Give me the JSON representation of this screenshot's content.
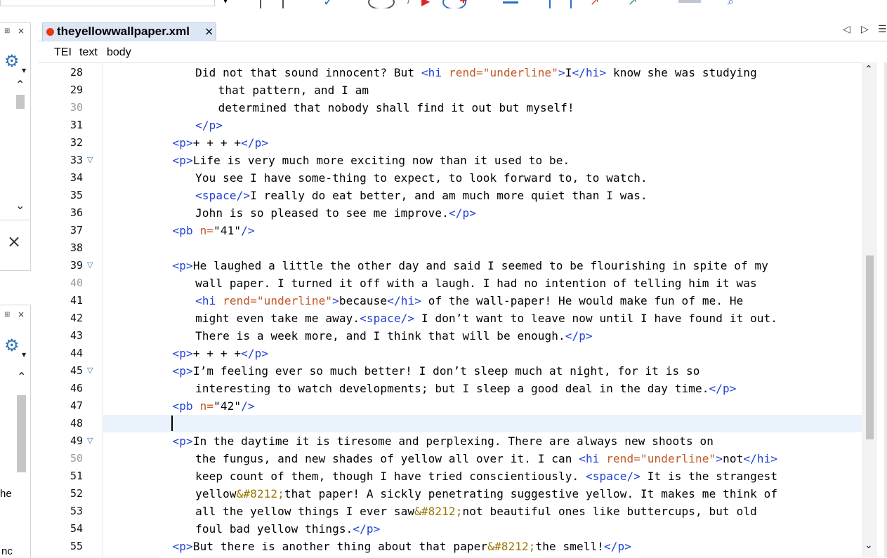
{
  "toolbar": {
    "icons": [
      "dropdown-icon",
      "validate-icon",
      "check-icon",
      "record-icon",
      "wand-icon",
      "run-icon",
      "debug-icon",
      "bug-icon",
      "bar-icon",
      "export-icon",
      "arrow-icon",
      "arrow2-icon",
      "book-icon",
      "search-icon"
    ]
  },
  "left_panels": {
    "upper": {
      "pin": "⊞",
      "close": "×",
      "closebig": "×"
    },
    "lower": {
      "pin": "⊞",
      "close": "×",
      "partial_text_1": "he",
      "partial_text_2": "nc"
    }
  },
  "tab": {
    "title": "theyellowwallpaper.xml",
    "close": "×",
    "modified_color": "#e8380d"
  },
  "breadcrumb": [
    "TEI",
    "text",
    "body"
  ],
  "editor": {
    "lines": [
      {
        "n": "28",
        "grey": false,
        "fold": false,
        "indent": 16,
        "parts": [
          [
            "t",
            "Did not that sound innocent? But "
          ],
          [
            "g",
            "<hi "
          ],
          [
            "a",
            "rend="
          ],
          [
            "a",
            "\"underline\""
          ],
          [
            "g",
            ">"
          ],
          [
            "t",
            "I"
          ],
          [
            "g",
            "</hi>"
          ],
          [
            "t",
            " know she was studying"
          ]
        ]
      },
      {
        "n": "29",
        "grey": false,
        "fold": false,
        "indent": 20,
        "parts": [
          [
            "t",
            "that pattern, and I am"
          ]
        ]
      },
      {
        "n": "30",
        "grey": true,
        "fold": false,
        "indent": 20,
        "parts": [
          [
            "t",
            "determined that nobody shall find it out but myself!"
          ]
        ]
      },
      {
        "n": "31",
        "grey": false,
        "fold": false,
        "indent": 16,
        "parts": [
          [
            "g",
            "</p>"
          ]
        ]
      },
      {
        "n": "32",
        "grey": false,
        "fold": false,
        "indent": 12,
        "parts": [
          [
            "g",
            "<p>"
          ],
          [
            "t",
            "+ + + +"
          ],
          [
            "g",
            "</p>"
          ]
        ]
      },
      {
        "n": "33",
        "grey": false,
        "fold": true,
        "indent": 12,
        "parts": [
          [
            "g",
            "<p>"
          ],
          [
            "t",
            "Life is very much more exciting now than it used to be."
          ]
        ]
      },
      {
        "n": "34",
        "grey": false,
        "fold": false,
        "indent": 16,
        "parts": [
          [
            "t",
            "You see I have some-thing to expect, to look forward to, to watch."
          ]
        ]
      },
      {
        "n": "35",
        "grey": false,
        "fold": false,
        "indent": 16,
        "parts": [
          [
            "g",
            "<space/>"
          ],
          [
            "t",
            "I really do eat better, and am much more quiet than I was."
          ]
        ]
      },
      {
        "n": "36",
        "grey": false,
        "fold": false,
        "indent": 16,
        "parts": [
          [
            "t",
            "John is so pleased to see me improve."
          ],
          [
            "g",
            "</p>"
          ]
        ]
      },
      {
        "n": "37",
        "grey": false,
        "fold": false,
        "indent": 12,
        "parts": [
          [
            "g",
            "<pb "
          ],
          [
            "a",
            "n="
          ],
          [
            "t",
            "\"41\""
          ],
          [
            "g",
            "/>"
          ]
        ]
      },
      {
        "n": "38",
        "grey": false,
        "fold": false,
        "indent": 0,
        "parts": []
      },
      {
        "n": "39",
        "grey": false,
        "fold": true,
        "indent": 12,
        "parts": [
          [
            "g",
            "<p>"
          ],
          [
            "t",
            "He laughed a little the other day and said I seemed to be flourishing in spite of my"
          ]
        ]
      },
      {
        "n": "40",
        "grey": true,
        "fold": false,
        "indent": 16,
        "parts": [
          [
            "t",
            "wall paper. I turned it off with a laugh. I had no intention of telling him it was"
          ]
        ]
      },
      {
        "n": "41",
        "grey": false,
        "fold": false,
        "indent": 16,
        "parts": [
          [
            "g",
            "<hi "
          ],
          [
            "a",
            "rend="
          ],
          [
            "a",
            "\"underline\""
          ],
          [
            "g",
            ">"
          ],
          [
            "t",
            "because"
          ],
          [
            "g",
            "</hi>"
          ],
          [
            "t",
            " of the wall-paper! He would make fun of me. He"
          ]
        ]
      },
      {
        "n": "42",
        "grey": false,
        "fold": false,
        "indent": 16,
        "parts": [
          [
            "t",
            "might even take me away."
          ],
          [
            "g",
            "<space/>"
          ],
          [
            "t",
            " I don’t want to leave now until I have found it out."
          ]
        ]
      },
      {
        "n": "43",
        "grey": false,
        "fold": false,
        "indent": 16,
        "parts": [
          [
            "t",
            "There is a week more, and I think that will be enough."
          ],
          [
            "g",
            "</p>"
          ]
        ]
      },
      {
        "n": "44",
        "grey": false,
        "fold": false,
        "indent": 12,
        "parts": [
          [
            "g",
            "<p>"
          ],
          [
            "t",
            "+ + + +"
          ],
          [
            "g",
            "</p>"
          ]
        ]
      },
      {
        "n": "45",
        "grey": false,
        "fold": true,
        "indent": 12,
        "parts": [
          [
            "g",
            "<p>"
          ],
          [
            "t",
            "I’m feeling ever so much better! I don’t sleep much at night, for it is so"
          ]
        ]
      },
      {
        "n": "46",
        "grey": false,
        "fold": false,
        "indent": 16,
        "parts": [
          [
            "t",
            "interesting to watch developments; but I sleep a good deal in the day time."
          ],
          [
            "g",
            "</p>"
          ]
        ]
      },
      {
        "n": "47",
        "grey": false,
        "fold": false,
        "indent": 12,
        "parts": [
          [
            "g",
            "<pb "
          ],
          [
            "a",
            "n="
          ],
          [
            "t",
            "\"42\""
          ],
          [
            "g",
            "/>"
          ]
        ]
      },
      {
        "n": "48",
        "grey": false,
        "fold": false,
        "indent": 0,
        "parts": []
      },
      {
        "n": "49",
        "grey": false,
        "fold": true,
        "indent": 12,
        "parts": [
          [
            "g",
            "<p>"
          ],
          [
            "t",
            "In the daytime it is tiresome and perplexing. There are always new shoots on"
          ]
        ]
      },
      {
        "n": "50",
        "grey": true,
        "fold": false,
        "indent": 16,
        "parts": [
          [
            "t",
            "the fungus, and new shades of yellow all over it. I can "
          ],
          [
            "g",
            "<hi "
          ],
          [
            "a",
            "rend="
          ],
          [
            "a",
            "\"underline\""
          ],
          [
            "g",
            ">"
          ],
          [
            "t",
            "not"
          ],
          [
            "g",
            "</hi>"
          ]
        ]
      },
      {
        "n": "51",
        "grey": false,
        "fold": false,
        "indent": 16,
        "parts": [
          [
            "t",
            "keep count of them, though I have tried conscientiously. "
          ],
          [
            "g",
            "<space/>"
          ],
          [
            "t",
            " It is the strangest"
          ]
        ]
      },
      {
        "n": "52",
        "grey": false,
        "fold": false,
        "indent": 16,
        "parts": [
          [
            "t",
            "yellow"
          ],
          [
            "e",
            "&#8212;"
          ],
          [
            "t",
            "that paper! A sickly penetrating suggestive yellow. It makes me think of"
          ]
        ]
      },
      {
        "n": "53",
        "grey": false,
        "fold": false,
        "indent": 16,
        "parts": [
          [
            "t",
            "all the yellow things I ever saw"
          ],
          [
            "e",
            "&#8212;"
          ],
          [
            "t",
            "not beautiful ones like buttercups, but old"
          ]
        ]
      },
      {
        "n": "54",
        "grey": false,
        "fold": false,
        "indent": 16,
        "parts": [
          [
            "t",
            "foul bad yellow things."
          ],
          [
            "g",
            "</p>"
          ]
        ]
      },
      {
        "n": "55",
        "grey": false,
        "fold": false,
        "indent": 12,
        "parts": [
          [
            "g",
            "<p>"
          ],
          [
            "t",
            "But there is another thing about that paper"
          ],
          [
            "e",
            "&#8212;"
          ],
          [
            "t",
            "the smell!"
          ],
          [
            "g",
            "</p>"
          ]
        ]
      }
    ],
    "current_line": "48"
  }
}
